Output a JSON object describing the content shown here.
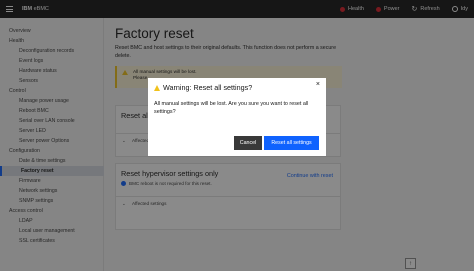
{
  "header": {
    "brand_prefix": "IBM",
    "brand_name": "eBMC",
    "actions": [
      {
        "label": "Health",
        "icon": "error-icon"
      },
      {
        "label": "Power",
        "icon": "error-icon"
      },
      {
        "label": "Refresh",
        "icon": "refresh-icon"
      },
      {
        "label": "Idy",
        "icon": "user-icon"
      }
    ]
  },
  "sidebar": {
    "items": [
      {
        "label": "Overview",
        "level": "top"
      },
      {
        "label": "Health",
        "level": "top"
      },
      {
        "label": "Deconfiguration records",
        "level": "sub"
      },
      {
        "label": "Event logs",
        "level": "sub"
      },
      {
        "label": "Hardware status",
        "level": "sub"
      },
      {
        "label": "Sensors",
        "level": "sub"
      },
      {
        "label": "Control",
        "level": "top"
      },
      {
        "label": "Manage power usage",
        "level": "sub"
      },
      {
        "label": "Reboot BMC",
        "level": "sub"
      },
      {
        "label": "Serial over LAN console",
        "level": "sub"
      },
      {
        "label": "Server LED",
        "level": "sub"
      },
      {
        "label": "Server power Options",
        "level": "sub"
      },
      {
        "label": "Configuration",
        "level": "top"
      },
      {
        "label": "Date & time settings",
        "level": "sub"
      },
      {
        "label": "Factory reset",
        "level": "sub",
        "active": true
      },
      {
        "label": "Firmware",
        "level": "sub"
      },
      {
        "label": "Network settings",
        "level": "sub"
      },
      {
        "label": "SNMP settings",
        "level": "sub"
      },
      {
        "label": "Access control",
        "level": "top"
      },
      {
        "label": "LDAP",
        "level": "sub"
      },
      {
        "label": "Local user management",
        "level": "sub"
      },
      {
        "label": "SSL certificates",
        "level": "sub"
      }
    ]
  },
  "main": {
    "title": "Factory reset",
    "description": "Reset BMC and host settings to their original defaults. This function does not perform a secure delete.",
    "alert": {
      "line1": "All manual settings will be lost.",
      "line2": "Please"
    },
    "card1": {
      "title": "Reset all",
      "affected_label": "Affected"
    },
    "card2": {
      "title": "Reset hypervisor settings only",
      "link": "Continue with reset",
      "info": "BMC reboot is not required for this reset.",
      "affected_label": "Affected settings"
    }
  },
  "modal": {
    "title": "Warning: Reset all settings?",
    "body": "All manual settings will be lost. Are you sure you want to reset all settings?",
    "cancel_label": "Cancel",
    "confirm_label": "Reset all settings",
    "close_glyph": "×"
  },
  "colors": {
    "accent": "#0f62fe",
    "warning": "#f1c21b",
    "error": "#da1e28",
    "header_bg": "#161616"
  }
}
